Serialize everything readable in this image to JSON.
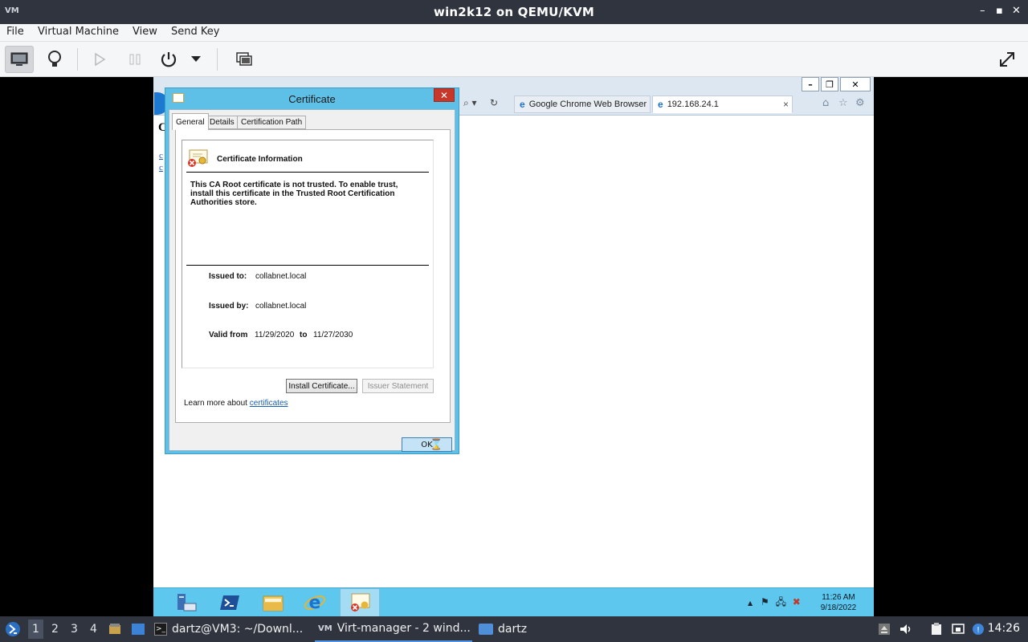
{
  "host_window": {
    "title": "win2k12 on QEMU/KVM",
    "app_icon": "VM",
    "controls": [
      "–",
      "▪",
      "✕"
    ]
  },
  "menubar": {
    "items": [
      "File",
      "Virtual Machine",
      "View",
      "Send Key"
    ]
  },
  "toolbar": {
    "icons": [
      "console-icon",
      "details-bulb-icon",
      "run-icon",
      "pause-icon",
      "power-icon",
      "power-menu-icon",
      "snapshots-icon",
      "fullscreen-icon"
    ]
  },
  "ie": {
    "controls": {
      "minimize": "–",
      "restore": "❐",
      "close": "✕"
    },
    "tabs": [
      {
        "label": "Google Chrome Web Browser"
      },
      {
        "label": "192.168.24.1"
      }
    ],
    "tab_close": "×",
    "page_heading_peek": "C",
    "page_links_peek": [
      "c",
      "c"
    ]
  },
  "cert_dialog": {
    "title": "Certificate",
    "close_glyph": "✕",
    "tabs": [
      "General",
      "Details",
      "Certification Path"
    ],
    "heading": "Certificate Information",
    "message": "This CA Root certificate is not trusted. To enable trust, install this certificate in the Trusted Root Certification Authorities store.",
    "issued_to_label": "Issued to:",
    "issued_to": "collabnet.local",
    "issued_by_label": "Issued by:",
    "issued_by": "collabnet.local",
    "valid_from_label": "Valid from",
    "valid_from": "11/29/2020",
    "valid_to_label": "to",
    "valid_to": "11/27/2030",
    "install_button": "Install Certificate...",
    "issuer_statement_button": "Issuer Statement",
    "learn_more_text": "Learn more about ",
    "learn_more_link": "certificates",
    "ok_button": "OK"
  },
  "win_taskbar": {
    "tray_arrow": "▲",
    "time": "11:26 AM",
    "date": "9/18/2022"
  },
  "host_panel": {
    "workspaces": [
      "1",
      "2",
      "3",
      "4"
    ],
    "tasks": [
      {
        "label": "dartz@VM3: ~/Downl..."
      },
      {
        "label": "Virt-manager - 2 wind..."
      },
      {
        "label": "dartz"
      }
    ],
    "clock": "14:26"
  },
  "colors": {
    "host_panel": "#2f343f",
    "win_taskbar": "#5ec7ee",
    "dialog_frame": "#5ebfe7",
    "close_red": "#c7382a"
  }
}
